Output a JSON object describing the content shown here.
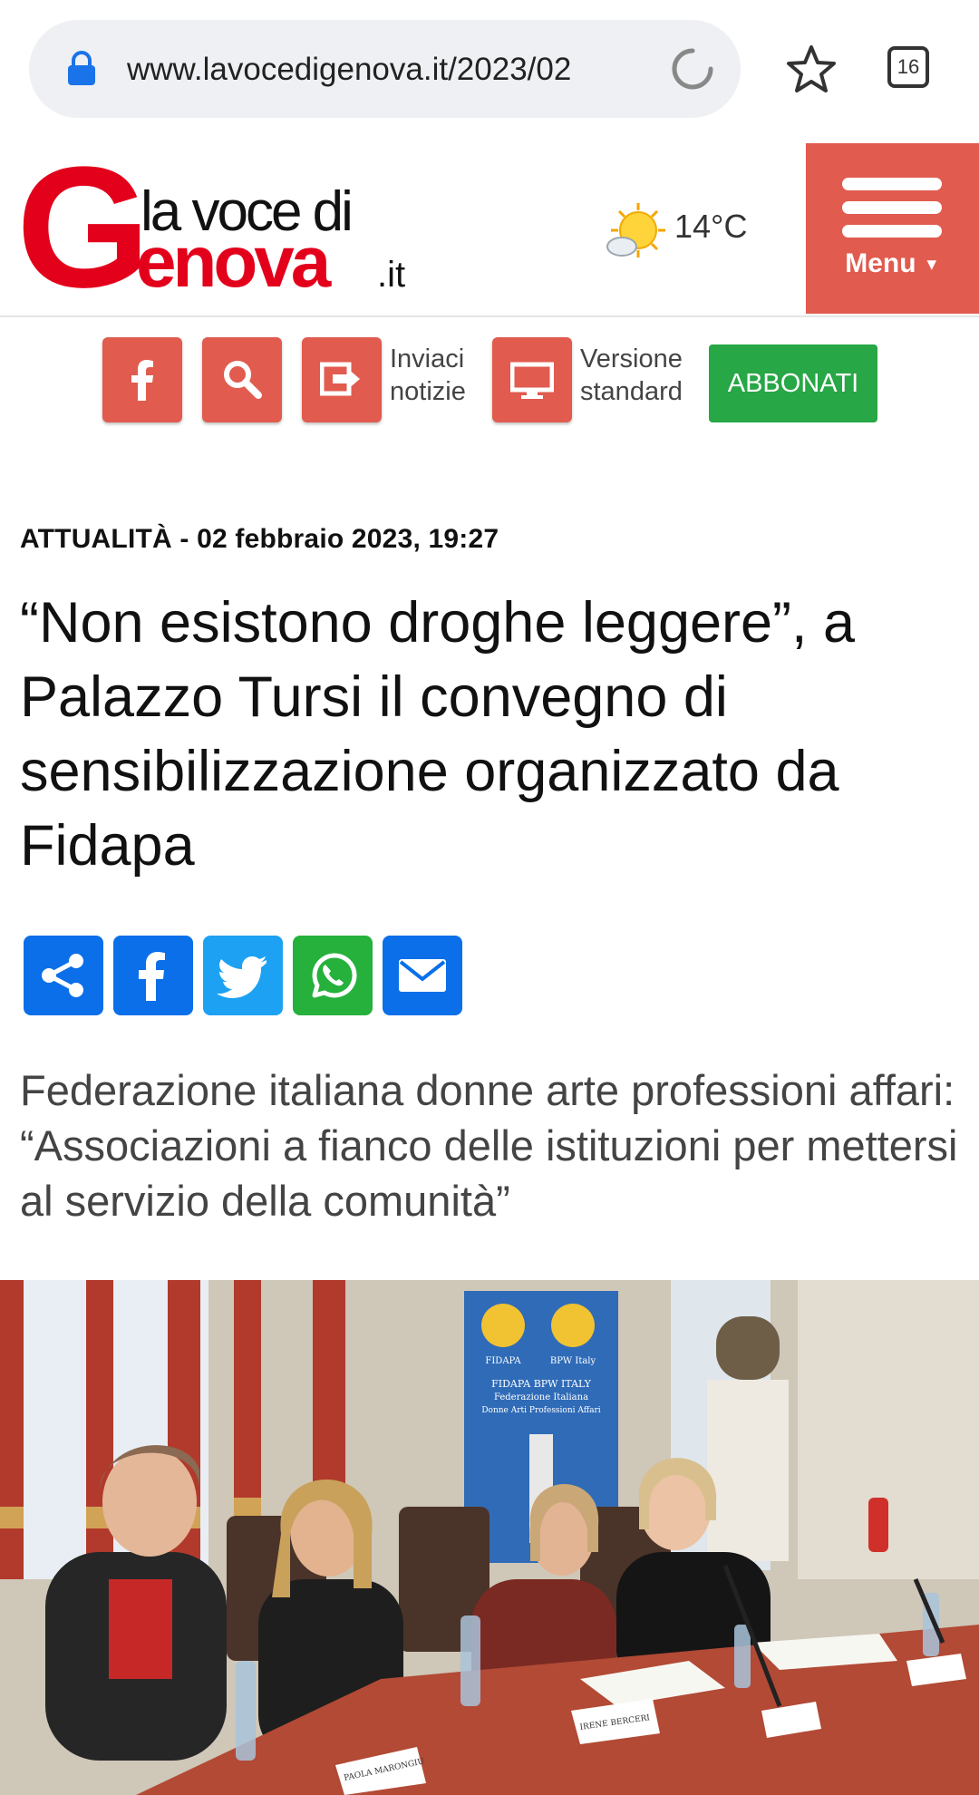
{
  "browser": {
    "url": "www.lavocedigenova.it/2023/02",
    "tab_count": "16",
    "icons": {
      "lock": "lock-icon",
      "reload": "reload-icon",
      "bookmark": "star-icon"
    }
  },
  "site": {
    "logo": {
      "line1": "la voce di",
      "line2": "Genova",
      "tld": ".it"
    },
    "weather": {
      "icon": "sun-cloud-icon",
      "temperature": "14°C"
    },
    "menu_label": "Menu"
  },
  "toolbar": {
    "send_news_line1": "Inviaci",
    "send_news_line2": "notizie",
    "standard_line1": "Versione",
    "standard_line2": "standard",
    "subscribe": "ABBONATI"
  },
  "article": {
    "meta": "ATTUALITÀ - 02 febbraio 2023, 19:27",
    "title": "“Non esistono droghe leggere”, a Palazzo Tursi il convegno di sensibilizzazione organizzato da Fidapa",
    "subtitle": "Federazione italiana donne arte professioni affari: “Associazioni a fianco delle istituzioni per mettersi al servizio della comunità”",
    "share_icons": [
      "share-icon",
      "facebook-icon",
      "twitter-icon",
      "whatsapp-icon",
      "email-icon"
    ]
  },
  "photo": {
    "banner_top_left": "FIDAPA",
    "banner_top_right": "BPW Italy",
    "banner_line1": "FIDAPA BPW ITALY",
    "banner_line2": "Federazione Italiana",
    "banner_line3": "Donne Arti Professioni Affari",
    "placard_1": "PAOLA MARONGIU",
    "placard_2": "IRENE BERCERI"
  },
  "colors": {
    "brand_red": "#e15b4f",
    "logo_red": "#e3001b",
    "subscribe_green": "#27a745",
    "share_blue": "#0a6fe8",
    "whatsapp_green": "#25b13c"
  }
}
